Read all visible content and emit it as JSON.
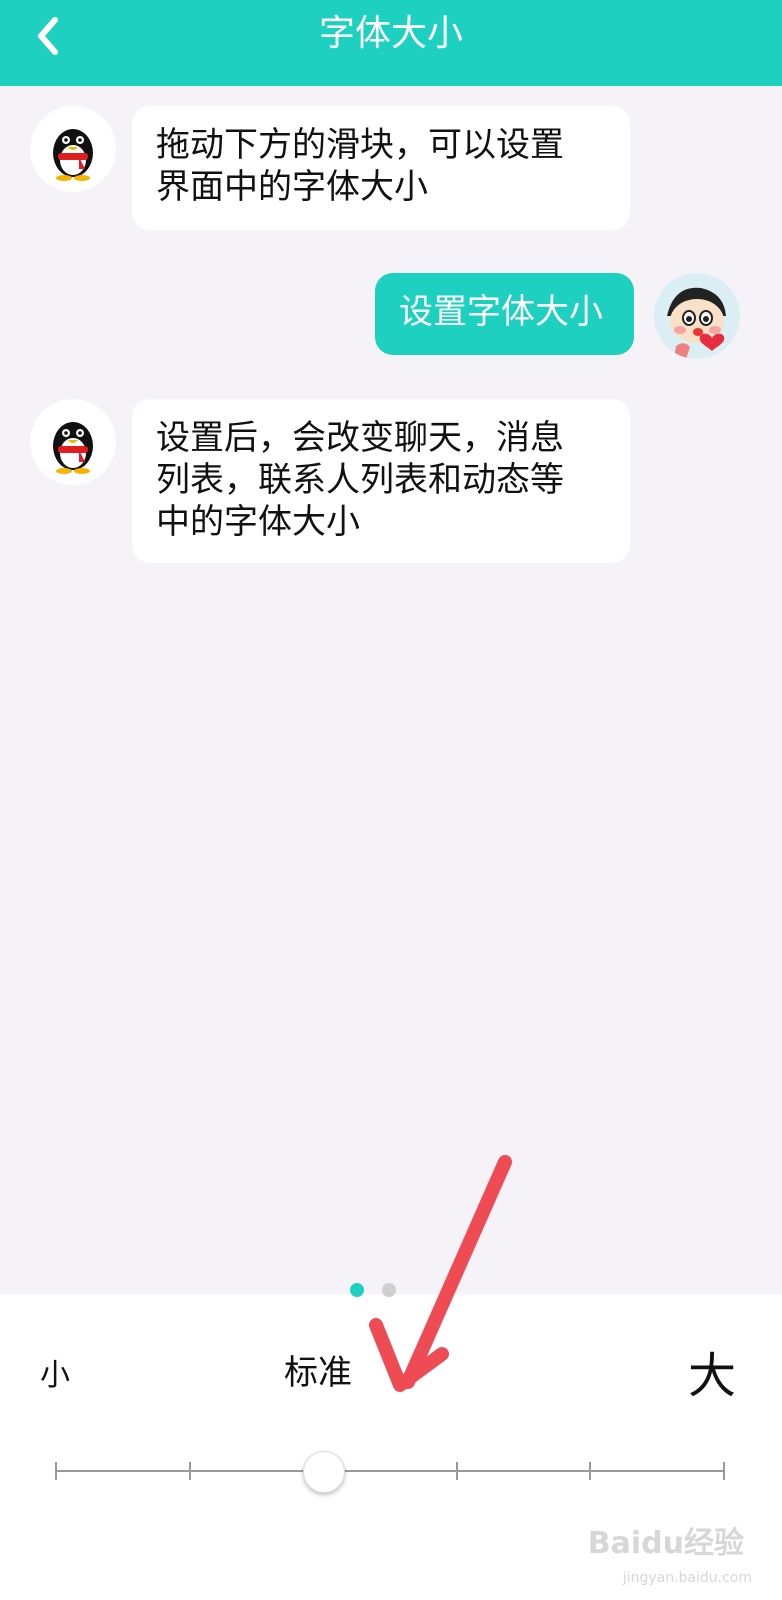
{
  "header": {
    "title": "字体大小",
    "back_icon": "chevron-left-icon"
  },
  "messages": [
    {
      "from": "bot",
      "text": "拖动下方的滑块，可以设置\n界面中的字体大小"
    },
    {
      "from": "user",
      "text": "设置字体大小"
    },
    {
      "from": "bot",
      "text": "设置后，会改变聊天，消息\n列表，联系人列表和动态等\n中的字体大小"
    }
  ],
  "slider": {
    "small_label": "小",
    "standard_label": "标准",
    "large_label": "大",
    "stops": 6,
    "selected_index": 2
  },
  "pager": {
    "active_index": 0,
    "count": 2
  },
  "watermark": {
    "brand": "Baidu经验",
    "url": "jingyan.baidu.com"
  },
  "colors": {
    "accent": "#1ed0bf",
    "background": "#f5f3f7",
    "arrow_annotation": "#ef4b54"
  }
}
